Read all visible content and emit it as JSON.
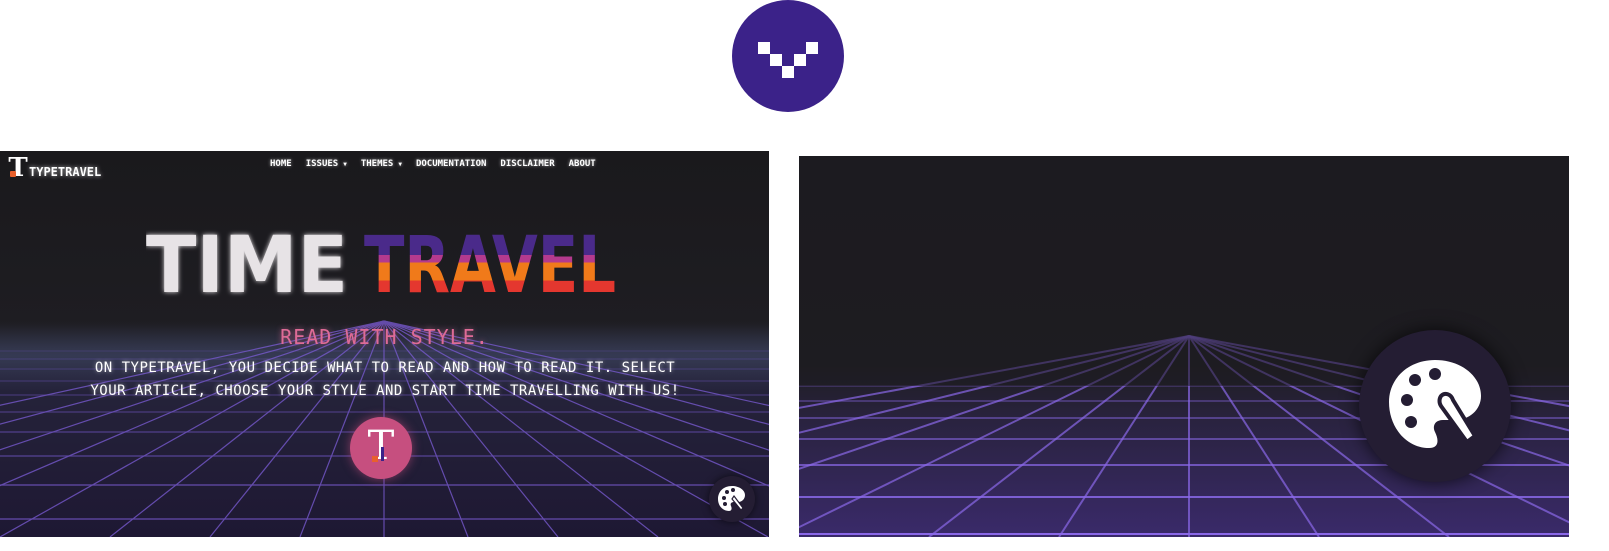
{
  "brand": {
    "name": "TYPETRAVEL",
    "logo_letter": "T",
    "badge_icon": "pixel-v-logo-icon",
    "badge_color": "#3b2289"
  },
  "nav": {
    "items": [
      {
        "label": "HOME",
        "has_caret": false
      },
      {
        "label": "ISSUES",
        "has_caret": true
      },
      {
        "label": "THEMES",
        "has_caret": true
      },
      {
        "label": "DOCUMENTATION",
        "has_caret": false
      },
      {
        "label": "DISCLAIMER",
        "has_caret": false
      },
      {
        "label": "ABOUT",
        "has_caret": false
      }
    ],
    "caret_icon": "caret-down-icon"
  },
  "hero": {
    "title_part1": "TIME",
    "title_part2": "TRAVEL",
    "tagline": "READ WITH STYLE.",
    "intro_line1": "ON TYPETRAVEL, YOU DECIDE WHAT TO READ AND HOW TO READ IT. SELECT",
    "intro_line2": "YOUR ARTICLE, CHOOSE YOUR STYLE AND START TIME TRAVELLING WITH US!",
    "center_logo_letter": "T"
  },
  "theme_button": {
    "icon": "palette-icon"
  },
  "colors": {
    "background_dark": "#1b1a1e",
    "grid_purple": "#7b5cd6",
    "tagline_pink": "#de6b96",
    "logo_pink": "#c64f7f",
    "retro_purple": "#4a2a8a",
    "retro_magenta": "#b43a8e",
    "retro_orange": "#f07a1a",
    "retro_red": "#e4372f"
  }
}
